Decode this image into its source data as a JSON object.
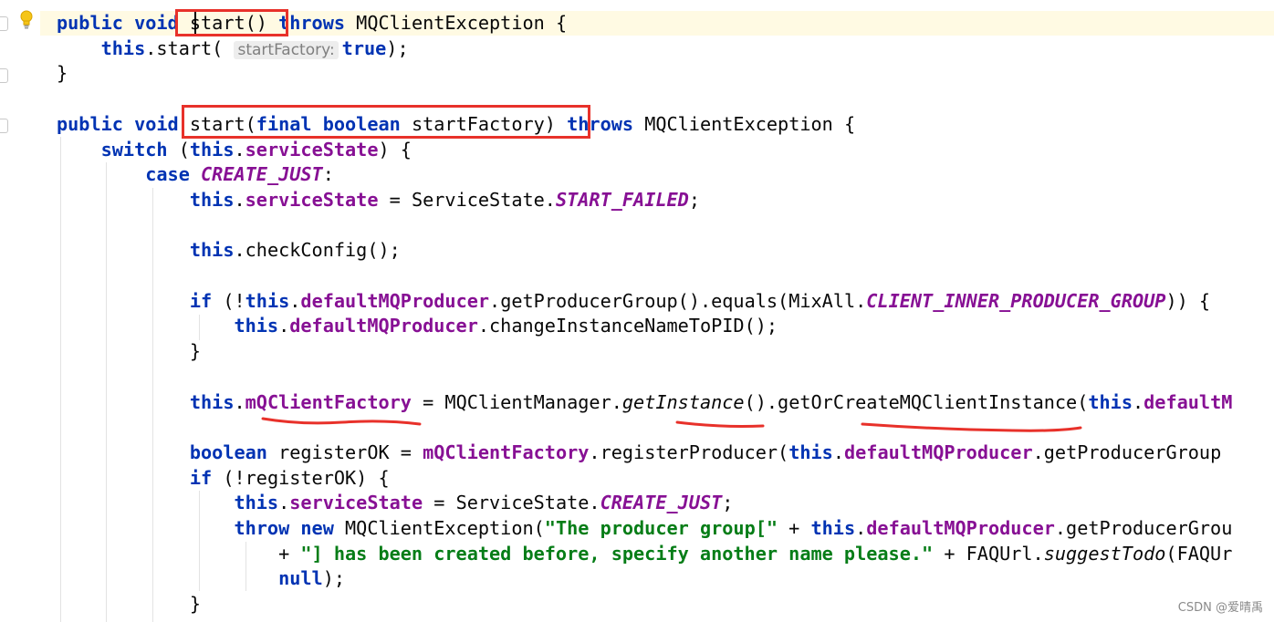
{
  "editor": {
    "lines": [
      [
        {
          "t": "public void ",
          "c": "kw"
        },
        {
          "t": "start() "
        },
        {
          "t": "throws ",
          "c": "kw"
        },
        {
          "t": "MQClientException {"
        }
      ],
      [
        {
          "t": "    "
        },
        {
          "t": "this",
          "c": "kw"
        },
        {
          "t": ".start( "
        },
        {
          "t": "startFactory:",
          "c": "hint"
        },
        {
          "t": "true",
          "c": "kw"
        },
        {
          "t": ");"
        }
      ],
      [
        {
          "t": "}"
        }
      ],
      [],
      [
        {
          "t": "public void ",
          "c": "kw"
        },
        {
          "t": "start("
        },
        {
          "t": "final boolean ",
          "c": "kw"
        },
        {
          "t": "startFactory) "
        },
        {
          "t": "throws ",
          "c": "kw"
        },
        {
          "t": "MQClientException {"
        }
      ],
      [
        {
          "t": "    "
        },
        {
          "t": "switch ",
          "c": "kw"
        },
        {
          "t": "("
        },
        {
          "t": "this",
          "c": "kw"
        },
        {
          "t": "."
        },
        {
          "t": "serviceState",
          "c": "fld"
        },
        {
          "t": ") {"
        }
      ],
      [
        {
          "t": "        "
        },
        {
          "t": "case ",
          "c": "kw"
        },
        {
          "t": "CREATE_JUST",
          "c": "cst"
        },
        {
          "t": ":"
        }
      ],
      [
        {
          "t": "            "
        },
        {
          "t": "this",
          "c": "kw"
        },
        {
          "t": "."
        },
        {
          "t": "serviceState",
          "c": "fld"
        },
        {
          "t": " = ServiceState."
        },
        {
          "t": "START_FAILED",
          "c": "cst"
        },
        {
          "t": ";"
        }
      ],
      [],
      [
        {
          "t": "            "
        },
        {
          "t": "this",
          "c": "kw"
        },
        {
          "t": ".checkConfig();"
        }
      ],
      [],
      [
        {
          "t": "            "
        },
        {
          "t": "if ",
          "c": "kw"
        },
        {
          "t": "(!"
        },
        {
          "t": "this",
          "c": "kw"
        },
        {
          "t": "."
        },
        {
          "t": "defaultMQProducer",
          "c": "fld"
        },
        {
          "t": ".getProducerGroup().equals(MixAll."
        },
        {
          "t": "CLIENT_INNER_PRODUCER_GROUP",
          "c": "cst"
        },
        {
          "t": ")) {"
        }
      ],
      [
        {
          "t": "                "
        },
        {
          "t": "this",
          "c": "kw"
        },
        {
          "t": "."
        },
        {
          "t": "defaultMQProducer",
          "c": "fld"
        },
        {
          "t": ".changeInstanceNameToPID();"
        }
      ],
      [
        {
          "t": "            }"
        }
      ],
      [],
      [
        {
          "t": "            "
        },
        {
          "t": "this",
          "c": "kw"
        },
        {
          "t": "."
        },
        {
          "t": "mQClientFactory",
          "c": "fld"
        },
        {
          "t": " = MQClientManager."
        },
        {
          "t": "getInstance",
          "c": "it"
        },
        {
          "t": "().getOrCreateMQClientInstance("
        },
        {
          "t": "this",
          "c": "kw"
        },
        {
          "t": "."
        },
        {
          "t": "defaultM",
          "c": "fld"
        }
      ],
      [],
      [
        {
          "t": "            "
        },
        {
          "t": "boolean ",
          "c": "kw"
        },
        {
          "t": "registerOK = "
        },
        {
          "t": "mQClientFactory",
          "c": "fld"
        },
        {
          "t": ".registerProducer("
        },
        {
          "t": "this",
          "c": "kw"
        },
        {
          "t": "."
        },
        {
          "t": "defaultMQProducer",
          "c": "fld"
        },
        {
          "t": ".getProducerGroup"
        }
      ],
      [
        {
          "t": "            "
        },
        {
          "t": "if ",
          "c": "kw"
        },
        {
          "t": "(!registerOK) {"
        }
      ],
      [
        {
          "t": "                "
        },
        {
          "t": "this",
          "c": "kw"
        },
        {
          "t": "."
        },
        {
          "t": "serviceState",
          "c": "fld"
        },
        {
          "t": " = ServiceState."
        },
        {
          "t": "CREATE_JUST",
          "c": "cst"
        },
        {
          "t": ";"
        }
      ],
      [
        {
          "t": "                "
        },
        {
          "t": "throw new ",
          "c": "kw"
        },
        {
          "t": "MQClientException("
        },
        {
          "t": "\"The producer group[\"",
          "c": "str"
        },
        {
          "t": " + "
        },
        {
          "t": "this",
          "c": "kw"
        },
        {
          "t": "."
        },
        {
          "t": "defaultMQProducer",
          "c": "fld"
        },
        {
          "t": ".getProducerGrou"
        }
      ],
      [
        {
          "t": "                    + "
        },
        {
          "t": "\"] has been created before, specify another name please.\"",
          "c": "str"
        },
        {
          "t": " + FAQUrl."
        },
        {
          "t": "suggestTodo",
          "c": "it"
        },
        {
          "t": "(FAQUr"
        }
      ],
      [
        {
          "t": "                    "
        },
        {
          "t": "null",
          "c": "kw"
        },
        {
          "t": ");"
        }
      ],
      [
        {
          "t": "            }"
        }
      ]
    ]
  },
  "watermark": "CSDN @爱晴禹",
  "colors": {
    "keyword": "#0033b3",
    "field": "#871094",
    "string": "#067d17",
    "annotation_box": "#e8312a",
    "underline": "#e8312a",
    "current_line": "#fffae3"
  },
  "icons": {
    "bulb": "lightbulb-icon",
    "fold": "fold-marker-icon"
  }
}
